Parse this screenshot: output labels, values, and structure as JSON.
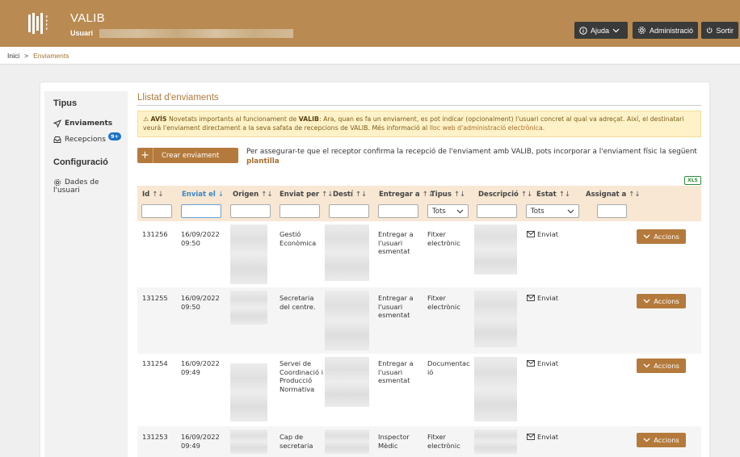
{
  "header": {
    "app_name": "VALIB",
    "user_label": "Usuari",
    "help_label": "Ajuda",
    "admin_label": "Administració",
    "logout_label": "Sortir"
  },
  "breadcrumb": {
    "home": "Inici",
    "separator": ">",
    "current": "Enviaments"
  },
  "sidebar": {
    "types_heading": "Tipus",
    "items": [
      {
        "label": "Enviaments",
        "active": true
      },
      {
        "label": "Recepcions",
        "badge": "9+"
      }
    ],
    "config_heading": "Configuració",
    "config_items": [
      {
        "label_line1": "Dades de",
        "label_line2": "l'usuari"
      }
    ]
  },
  "main": {
    "title": "Llistat d'enviaments",
    "notice": {
      "icon": "⚠",
      "label": "AVÍS",
      "text_a": "Novetats importants al funcionament de ",
      "brand": "VALIB",
      "text_b": ": Ara, quan es fa un enviament, es pot indicar (opcionalment) l'usuari concret al qual va adreçat. Així, el destinatari veurà l'enviament directament a la seva safata de recepcions de VALIB. Més informació al ",
      "link": "lloc web d'administració electrònica",
      "text_c": "."
    },
    "create_button": "Crear enviament",
    "confirm_text": "Per assegurar-te que el receptor confirma la recepció de l'enviament amb VALIB, pots incorporar a l'enviament físic la següent",
    "confirm_link": "plantilla",
    "export_label": "XLS"
  },
  "table": {
    "columns": [
      {
        "key": "id",
        "label": "Id"
      },
      {
        "key": "enviat_el",
        "label": "Enviat el"
      },
      {
        "key": "origen",
        "label": "Origen"
      },
      {
        "key": "enviat_per",
        "label": "Enviat per"
      },
      {
        "key": "desti",
        "label": "Destí"
      },
      {
        "key": "entregar_a",
        "label": "Entregar a"
      },
      {
        "key": "tipus",
        "label": "Tipus"
      },
      {
        "key": "descripcio",
        "label": "Descripció"
      },
      {
        "key": "estat",
        "label": "Estat"
      },
      {
        "key": "assignat_a",
        "label": "Assignat a"
      }
    ],
    "sort_glyph": "↑↓",
    "sorted_glyph": "↓",
    "filter_tipus": "Tots",
    "filter_estat": "Tots",
    "rows": [
      {
        "id": "131256",
        "date": "16/09/2022",
        "time": "09:50",
        "enviat_per": [
          "Gestió",
          "Econòmica"
        ],
        "entregar_a": [
          "Entregar a",
          "l'usuari",
          "esmentat"
        ],
        "tipus": [
          "Fitxer",
          "electrònic"
        ],
        "estat": "Enviat",
        "action": "Accions"
      },
      {
        "id": "131255",
        "date": "16/09/2022",
        "time": "09:50",
        "enviat_per": [
          "Secretaria",
          "del centre."
        ],
        "entregar_a": [
          "Entregar a",
          "l'usuari",
          "esmentat"
        ],
        "tipus": [
          "Fitxer",
          "electrònic"
        ],
        "estat": "Enviat",
        "action": "Accions"
      },
      {
        "id": "131254",
        "date": "16/09/2022",
        "time": "09:49",
        "enviat_per": [
          "Servei de",
          "Coordinació i",
          "Producció",
          "Normativa"
        ],
        "entregar_a": [
          "Entregar a",
          "l'usuari",
          "esmentat"
        ],
        "tipus": [
          "Documentac",
          "ió"
        ],
        "estat": "Enviat",
        "action": "Accions"
      },
      {
        "id": "131253",
        "date": "16/09/2022",
        "time": "09:49",
        "enviat_per": [
          "Cap de",
          "secretaria"
        ],
        "entregar_a": [
          "Inspector",
          "Mèdic"
        ],
        "tipus": [
          "Fitxer",
          "electrònic"
        ],
        "estat": "Enviat",
        "action": "Accions"
      }
    ]
  },
  "colors": {
    "header_bg": "#b98a51",
    "accent": "#b47a3c",
    "link": "#a66d2a",
    "table_header_bg": "#f7e7d3",
    "notice_bg": "#fff2c8",
    "sorted_blue": "#3a86c8",
    "badge_blue": "#1a73c8"
  }
}
